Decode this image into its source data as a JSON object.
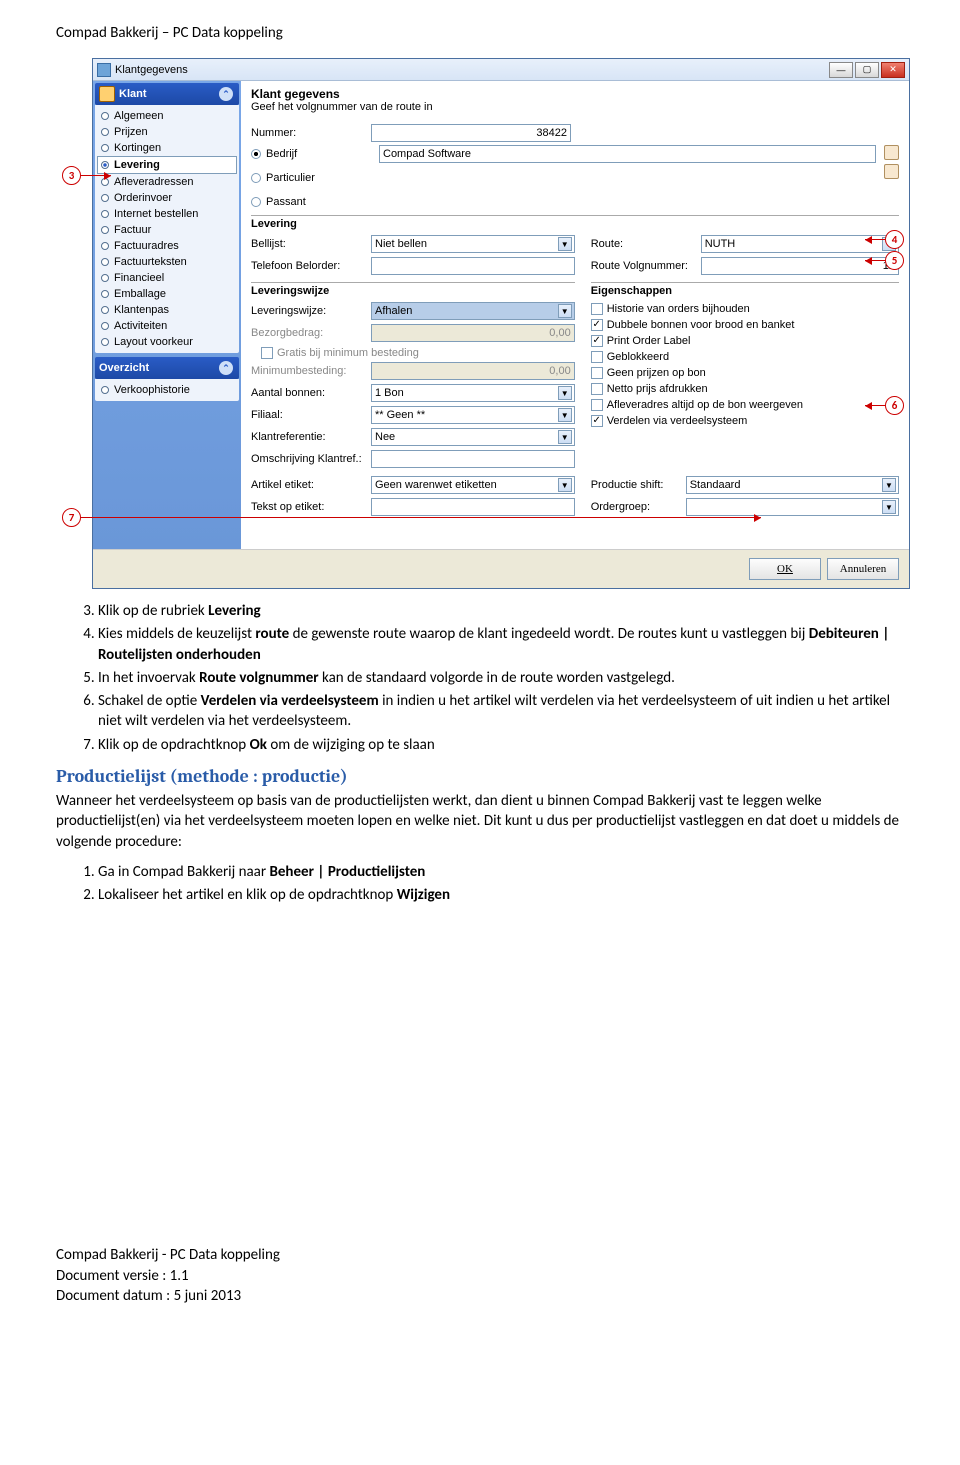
{
  "doc": {
    "header": "Compad Bakkerij – PC Data koppeling",
    "footer_line1": "Compad Bakkerij  - PC Data koppeling",
    "footer_line2": "Document versie : 1.1",
    "footer_line3": "Document datum : 5 juni 2013"
  },
  "callouts": {
    "c3": "3",
    "c4": "4",
    "c5": "5",
    "c6": "6",
    "c7": "7"
  },
  "window": {
    "title": "Klantgegevens",
    "sidebar": {
      "group1": {
        "title": "Klant",
        "items": [
          "Algemeen",
          "Prijzen",
          "Kortingen",
          "Levering",
          "Afleveradressen",
          "Orderinvoer",
          "Internet bestellen",
          "Factuur",
          "Factuuradres",
          "Factuurteksten",
          "Financieel",
          "Emballage",
          "Klantenpas",
          "Activiteiten",
          "Layout voorkeur"
        ],
        "selected_index": 3
      },
      "group2": {
        "title": "Overzicht",
        "items": [
          "Verkoophistorie"
        ]
      }
    },
    "main": {
      "heading": "Klant gegevens",
      "subtitle": "Geef het volgnummer van de route in",
      "nummer_label": "Nummer:",
      "nummer_value": "38422",
      "type_bedrijf": "Bedrijf",
      "type_particulier": "Particulier",
      "type_passant": "Passant",
      "bedrijf_value": "Compad Software",
      "levering_section": "Levering",
      "bellijst_label": "Bellijst:",
      "bellijst_value": "Niet bellen",
      "route_label": "Route:",
      "route_value": "NUTH",
      "telefoon_label": "Telefoon Belorder:",
      "route_volgnr_label": "Route Volgnummer:",
      "route_volgnr_value": "12",
      "leveringswijze_section": "Leveringswijze",
      "eigenschappen_section": "Eigenschappen",
      "leveringswijze_label": "Leveringswijze:",
      "leveringswijze_value": "Afhalen",
      "bezorgbedrag_label": "Bezorgbedrag:",
      "bezorgbedrag_value": "0,00",
      "gratis_min_besteding": "Gratis bij minimum besteding",
      "minimumbesteding_label": "Minimumbesteding:",
      "minimumbesteding_value": "0,00",
      "aantal_bonnen_label": "Aantal bonnen:",
      "aantal_bonnen_value": "1 Bon",
      "filiaal_label": "Filiaal:",
      "filiaal_value": "** Geen **",
      "klantreferentie_label": "Klantreferentie:",
      "klantreferentie_value": "Nee",
      "omschrijving_label": "Omschrijving Klantref.:",
      "artikel_etiket_label": "Artikel etiket:",
      "artikel_etiket_value": "Geen warenwet etiketten",
      "tekst_etiket_label": "Tekst op etiket:",
      "productie_shift_label": "Productie shift:",
      "productie_shift_value": "Standaard",
      "ordergroep_label": "Ordergroep:",
      "chk_historie": "Historie van orders bijhouden",
      "chk_dubbele": "Dubbele bonnen voor brood en banket",
      "chk_print": "Print Order Label",
      "chk_geblokkeerd": "Geblokkeerd",
      "chk_geenprijzen": "Geen prijzen op bon",
      "chk_netto": "Netto prijs afdrukken",
      "chk_afleveradres": "Afleveradres altijd op de bon weergeven",
      "chk_verdelen": "Verdelen via verdeelsysteem"
    },
    "buttons": {
      "ok": "OK",
      "annuleren": "Annuleren"
    }
  },
  "steps_first": [
    {
      "n": "3.",
      "pre": "Klik op de rubriek ",
      "b": "Levering",
      "post": ""
    },
    {
      "n": "4.",
      "pre": "Kies middels de keuzelijst ",
      "b": "route",
      "post": " de gewenste route waarop de klant ingedeeld wordt. De routes kunt u vastleggen bij ",
      "b2": "Debiteuren | Routelijsten onderhouden"
    },
    {
      "n": "5.",
      "pre": "In het invoervak ",
      "b": "Route volgnummer",
      "post": " kan de standaard volgorde in de route worden vastgelegd."
    },
    {
      "n": "6.",
      "pre": "Schakel de optie ",
      "b": "Verdelen via verdeelsysteem",
      "post": " in indien u het artikel wilt verdelen via het verdeelsysteem of uit indien u het artikel niet wilt verdelen via het verdeelsysteem."
    },
    {
      "n": "7.",
      "pre": "Klik op de opdrachtknop ",
      "b": "Ok",
      "post": " om de wijziging op te slaan"
    }
  ],
  "section2": {
    "title": "Productielijst (methode : productie)",
    "para": "Wanneer het verdeelsysteem op basis van de productielijsten werkt, dan dient u binnen Compad Bakkerij vast te leggen welke productielijst(en) via het verdeelsysteem moeten lopen en welke niet. Dit kunt u dus per productielijst vastleggen en dat doet u middels de volgende procedure:",
    "steps": [
      {
        "n": "1.",
        "pre": "Ga in Compad Bakkerij naar ",
        "b": "Beheer | Productielijsten",
        "post": ""
      },
      {
        "n": "2.",
        "pre": "Lokaliseer het artikel en klik op de opdrachtknop ",
        "b": "Wijzigen",
        "post": ""
      }
    ]
  }
}
